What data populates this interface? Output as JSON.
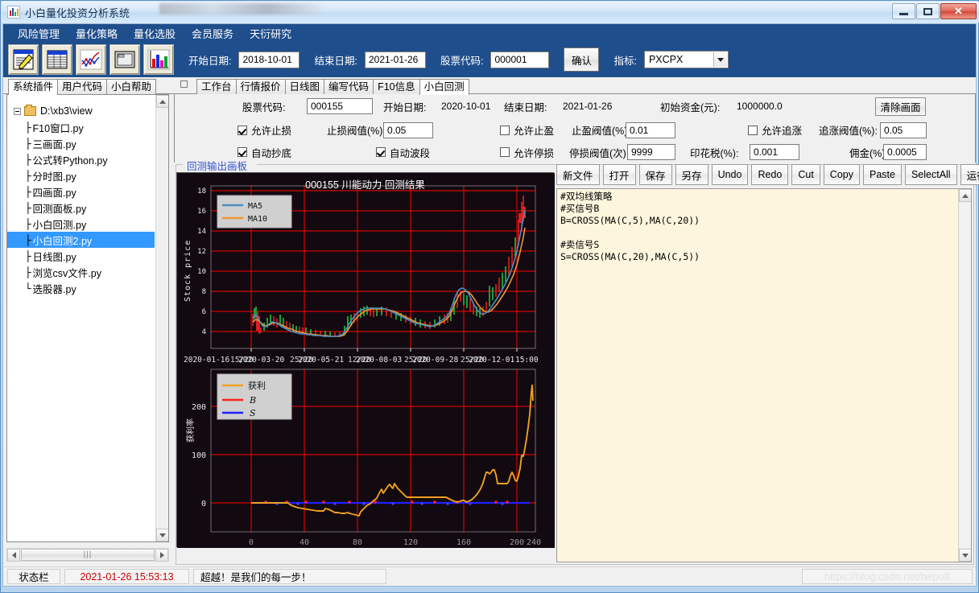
{
  "window": {
    "title": "小白量化投资分析系统",
    "icon": "chart-app-icon",
    "buttons": {
      "minimize": "minimize-icon",
      "maximize": "maximize-icon",
      "close": "✕"
    }
  },
  "menubar": {
    "items": [
      "风险管理",
      "量化策略",
      "量化选股",
      "会员服务",
      "天衍研究"
    ]
  },
  "toolbar": {
    "icons": [
      "edit-document-icon",
      "table-icon",
      "line-chart-icon",
      "window-icon",
      "bar-chart-icon"
    ],
    "start_date_label": "开始日期:",
    "start_date_value": "2018-10-01",
    "end_date_label": "结束日期:",
    "end_date_value": "2021-01-26",
    "stock_code_label": "股票代码:",
    "stock_code_value": "000001",
    "confirm_label": "确认",
    "indicator_label": "指标:",
    "indicator_value": "PXCPX"
  },
  "left_panel": {
    "tabs": [
      {
        "label": "系统插件",
        "active": true
      },
      {
        "label": "用户代码",
        "active": false
      },
      {
        "label": "小白帮助",
        "active": false
      }
    ],
    "tree_root": "D:\\xb3\\view",
    "tree_items": [
      {
        "label": "F10窗口.py",
        "last": false,
        "selected": false
      },
      {
        "label": "三画面.py",
        "last": false,
        "selected": false
      },
      {
        "label": "公式转Python.py",
        "last": false,
        "selected": false
      },
      {
        "label": "分时图.py",
        "last": false,
        "selected": false
      },
      {
        "label": "四画面.py",
        "last": false,
        "selected": false
      },
      {
        "label": "回测面板.py",
        "last": false,
        "selected": false
      },
      {
        "label": "小白回测.py",
        "last": false,
        "selected": false
      },
      {
        "label": "小白回测2.py",
        "last": false,
        "selected": true
      },
      {
        "label": "日线图.py",
        "last": false,
        "selected": false
      },
      {
        "label": "浏览csv文件.py",
        "last": false,
        "selected": false
      },
      {
        "label": "选股器.py",
        "last": true,
        "selected": false
      }
    ]
  },
  "right_panel": {
    "tabs": [
      {
        "label": "工作台",
        "active": false
      },
      {
        "label": "行情报价",
        "active": false
      },
      {
        "label": "日线图",
        "active": false
      },
      {
        "label": "编写代码",
        "active": false
      },
      {
        "label": "F10信息",
        "active": false
      },
      {
        "label": "小白回测",
        "active": true
      }
    ],
    "form": {
      "stock_code_label": "股票代码:",
      "stock_code_value": "000155",
      "start_date_label": "开始日期:",
      "start_date_value": "2020-10-01",
      "end_date_label": "结束日期:",
      "end_date_value": "2021-01-26",
      "initial_capital_label": "初始资金(元):",
      "initial_capital_value": "1000000.0",
      "clear_button": "清除画面",
      "allow_stoploss_label": "允许止损",
      "allow_stoploss_checked": true,
      "stoploss_threshold_label": "止损阀值(%):",
      "stoploss_threshold_value": "0.05",
      "allow_takeprofit_label": "允许止盈",
      "allow_takeprofit_checked": false,
      "takeprofit_threshold_label": "止盈阀值(%):",
      "takeprofit_threshold_value": "0.01",
      "allow_chase_label": "允许追涨",
      "allow_chase_checked": false,
      "chase_threshold_label": "追涨阀值(%):",
      "chase_threshold_value": "0.05",
      "auto_bottom_label": "自动抄底",
      "auto_bottom_checked": true,
      "auto_band_label": "自动波段",
      "auto_band_checked": true,
      "allow_halt_label": "允许停损",
      "allow_halt_checked": false,
      "halt_threshold_label": "停损阀值(次):",
      "halt_threshold_value": "9999",
      "stamp_tax_label": "印花税(%):",
      "stamp_tax_value": "0.001",
      "commission_label": "佣金(%):",
      "commission_value": "0.0005"
    },
    "groupbox_title": "回测输出画板"
  },
  "editor": {
    "buttons": [
      "新文件",
      "打开",
      "保存",
      "另存",
      "Undo",
      "Redo",
      "Cut",
      "Copy",
      "Paste",
      "SelectAll",
      "运行程序"
    ],
    "code": "#双均线策略\n#买信号B\nB=CROSS(MA(C,5),MA(C,20))\n\n#卖信号S\nS=CROSS(MA(C,20),MA(C,5))"
  },
  "statusbar": {
    "label": "状态栏",
    "datetime": "2021-01-26  15:53:13",
    "message": "超越！是我们的每一步！",
    "watermark": "https://blog.csdn.net/hepu8"
  },
  "chart_data": [
    {
      "type": "line",
      "id": "price-panel",
      "title": "000155 川能动力   回测结果",
      "xlabel": "",
      "ylabel": "Stock price",
      "ylim": [
        3.2,
        18.6
      ],
      "yticks": [
        4,
        6,
        8,
        10,
        12,
        14,
        16,
        18
      ],
      "xticks": [
        "2020-01-16",
        "2020-03-20",
        "2020-05-21",
        "2020-08-03",
        "2020-09-28",
        "2020-12-01",
        "15:00"
      ],
      "grid": true,
      "grid_color": "#ff0000",
      "bg_color": "#120a10",
      "legend_position": "upper-left",
      "legend": [
        "MA5",
        "MA10"
      ],
      "series": [
        {
          "name": "MA5",
          "color": "#4c8ec4",
          "values": [
            4.9,
            5.1,
            5.2,
            5.0,
            4.7,
            4.5,
            4.45,
            4.5,
            4.6,
            4.7,
            4.8,
            4.85,
            4.9,
            4.85,
            4.75,
            4.65,
            4.55,
            4.45,
            4.35,
            4.3,
            4.25,
            4.2,
            4.15,
            4.12,
            4.1,
            4.08,
            4.05,
            4.02,
            4.0,
            4.0,
            3.98,
            3.96,
            3.95,
            3.95,
            3.96,
            3.98,
            4.0,
            4.02,
            4.05,
            4.05,
            4.02,
            4.0,
            3.98,
            3.95,
            3.93,
            3.92,
            3.9,
            3.88,
            3.88,
            3.9,
            3.95,
            4.1,
            4.3,
            4.5,
            4.7,
            4.85,
            5.0,
            5.15,
            5.3,
            5.4,
            5.5,
            5.58,
            5.62,
            5.6,
            5.55,
            5.5,
            5.45,
            5.42,
            5.38,
            5.35,
            5.3,
            5.3,
            5.35,
            5.42,
            5.5,
            5.55,
            5.55,
            5.5,
            5.45,
            5.4,
            5.38,
            5.35,
            5.3,
            5.28,
            5.25,
            5.2,
            5.15,
            5.1,
            5.05,
            5.0,
            4.95,
            4.9,
            4.85,
            4.8,
            4.75,
            4.72,
            4.7,
            4.68,
            4.65,
            4.62,
            4.6,
            4.65,
            4.75,
            4.85,
            4.9,
            4.88,
            4.85,
            4.85,
            4.9,
            4.95,
            5.0,
            5.1,
            5.2,
            5.35,
            5.5,
            5.7,
            6.0,
            6.5,
            7.1,
            7.5,
            7.6,
            7.5,
            7.3,
            7.2,
            7.35,
            7.5,
            7.45,
            7.3,
            7.0,
            6.8,
            6.6,
            6.5,
            6.45,
            6.4,
            6.45,
            6.6,
            6.8,
            7.0,
            7.3,
            7.6,
            7.9,
            8.2,
            8.5,
            8.8,
            9.0,
            9.2,
            9.5,
            9.8,
            10.2,
            10.8,
            11.5,
            12.3,
            13.2,
            14.2,
            15.2,
            15.6
          ],
          "linewidth": 1.5
        },
        {
          "name": "MA10",
          "color": "#f0962e",
          "values": [
            4.85,
            5.0,
            5.05,
            5.0,
            4.85,
            4.7,
            4.6,
            4.6,
            4.65,
            4.72,
            4.8,
            4.85,
            4.88,
            4.85,
            4.8,
            4.72,
            4.62,
            4.52,
            4.45,
            4.38,
            4.32,
            4.28,
            4.22,
            4.18,
            4.15,
            4.12,
            4.1,
            4.07,
            4.05,
            4.03,
            4.0,
            3.98,
            3.97,
            3.96,
            3.96,
            3.97,
            3.99,
            4.0,
            4.02,
            4.03,
            4.03,
            4.0,
            3.98,
            3.96,
            3.94,
            3.93,
            3.92,
            3.9,
            3.88,
            3.88,
            3.9,
            3.98,
            4.12,
            4.3,
            4.5,
            4.68,
            4.85,
            5.0,
            5.15,
            5.28,
            5.4,
            5.48,
            5.55,
            5.58,
            5.57,
            5.54,
            5.5,
            5.45,
            5.42,
            5.38,
            5.35,
            5.32,
            5.32,
            5.35,
            5.4,
            5.46,
            5.5,
            5.5,
            5.48,
            5.44,
            5.4,
            5.38,
            5.35,
            5.32,
            5.28,
            5.25,
            5.2,
            5.16,
            5.12,
            5.08,
            5.02,
            4.98,
            4.92,
            4.88,
            4.82,
            4.78,
            4.75,
            4.72,
            4.7,
            4.68,
            4.66,
            4.66,
            4.7,
            4.78,
            4.84,
            4.86,
            4.86,
            4.86,
            4.88,
            4.92,
            4.96,
            5.02,
            5.1,
            5.2,
            5.32,
            5.48,
            5.7,
            6.05,
            6.5,
            6.9,
            7.2,
            7.35,
            7.4,
            7.4,
            7.45,
            7.48,
            7.45,
            7.3,
            7.1,
            6.9,
            6.75,
            6.62,
            6.52,
            6.45,
            6.42,
            6.45,
            6.55,
            6.7,
            6.9,
            7.15,
            7.4,
            7.65,
            7.9,
            8.15,
            8.4,
            8.6,
            8.85,
            9.1,
            9.4,
            9.8,
            10.3,
            10.9,
            11.6,
            12.4,
            13.0,
            13.55
          ],
          "linewidth": 1.5
        }
      ]
    },
    {
      "type": "line",
      "id": "profit-panel",
      "title": "",
      "xlabel": "",
      "ylabel": "获利率",
      "ylim": [
        -30,
        265
      ],
      "yticks": [
        0,
        100,
        200
      ],
      "xticks": [
        0,
        40,
        80,
        120,
        160,
        200,
        240
      ],
      "xlim": [
        -8,
        250
      ],
      "grid": true,
      "grid_color": "#ff0000",
      "bg_color": "#120a10",
      "legend_position": "upper-left",
      "legend": [
        "获利",
        "B",
        "S"
      ],
      "series": [
        {
          "name": "获利",
          "color": "#f0a020",
          "values": [
            0,
            0,
            0,
            0,
            0,
            0,
            0,
            0,
            0,
            0,
            0,
            0,
            0,
            0,
            0,
            0,
            0,
            0,
            0,
            0,
            0,
            0,
            0,
            0,
            0,
            0,
            0,
            0,
            -3,
            -4,
            -5,
            -6,
            -6,
            -7,
            -8,
            -8,
            -9,
            -9,
            -10,
            -10,
            -10,
            -10,
            -10,
            -10,
            -11,
            -12,
            -7,
            -8,
            -10,
            -12,
            -13,
            -13,
            -14,
            -14,
            -14,
            -13,
            -13,
            -14,
            -15,
            -16,
            -17,
            -18,
            -18,
            -17,
            -15,
            -13,
            -8,
            -4,
            -2,
            0,
            1,
            2,
            3,
            5,
            8,
            12,
            20,
            25,
            22,
            26,
            30,
            33,
            36,
            33,
            30,
            38,
            35,
            30,
            28,
            25,
            22,
            20,
            15,
            13,
            12,
            12,
            12,
            12,
            12,
            12,
            12,
            12,
            12,
            12,
            12,
            12,
            12,
            12,
            12,
            12,
            12,
            12,
            12,
            12,
            12,
            12,
            12,
            12,
            12,
            12,
            12,
            12,
            10,
            8,
            6,
            4,
            3,
            3,
            4,
            5,
            5,
            4,
            3,
            4,
            6,
            8,
            10,
            12,
            15,
            18,
            20,
            22,
            25,
            30,
            38,
            48,
            58,
            62,
            60,
            58,
            62,
            64,
            60,
            52,
            44,
            40,
            40,
            40,
            40,
            40,
            40,
            45,
            55,
            62,
            58,
            52,
            60,
            75,
            80,
            78,
            100,
            110,
            130,
            150,
            170,
            195,
            220,
            240,
            250,
            215
          ],
          "linewidth": 1.8
        },
        {
          "name": "B",
          "color": "#ff2020",
          "marker": "dot",
          "linewidth": 2
        },
        {
          "name": "S",
          "color": "#2020ff",
          "marker": "dot",
          "linewidth": 2
        }
      ]
    }
  ]
}
